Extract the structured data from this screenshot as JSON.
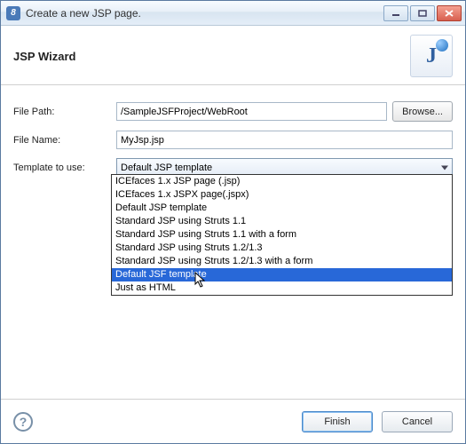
{
  "titlebar": {
    "title": "Create a new JSP page."
  },
  "header": {
    "title": "JSP Wizard"
  },
  "form": {
    "file_path_label": "File Path:",
    "file_path_value": "/SampleJSFProject/WebRoot",
    "browse_label": "Browse...",
    "file_name_label": "File Name:",
    "file_name_value": "MyJsp.jsp",
    "template_label": "Template to use:",
    "template_selected": "Default JSP template"
  },
  "dropdown": {
    "options": [
      "ICEfaces 1.x JSP page (.jsp)",
      "ICEfaces 1.x JSPX page(.jspx)",
      "Default JSP template",
      "Standard JSP using Struts 1.1",
      "Standard JSP using Struts 1.1 with a form",
      "Standard JSP using Struts 1.2/1.3",
      "Standard JSP using Struts 1.2/1.3 with a form",
      "Default JSF template",
      "Just as HTML"
    ],
    "highlighted_index": 7
  },
  "footer": {
    "finish_label": "Finish",
    "cancel_label": "Cancel"
  }
}
